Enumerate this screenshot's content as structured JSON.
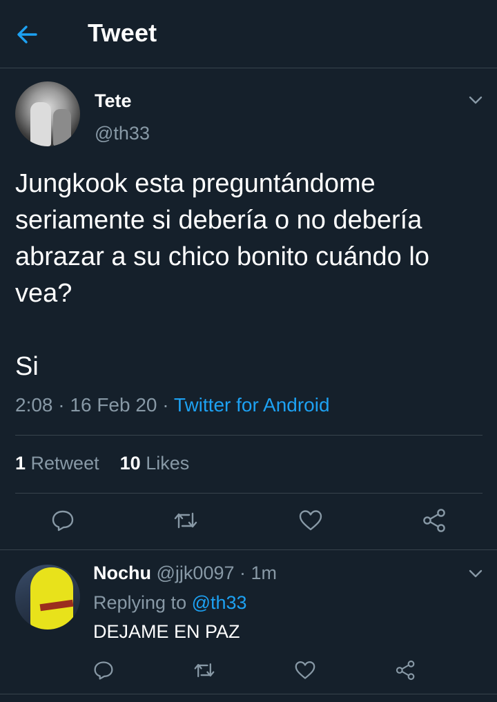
{
  "header": {
    "title": "Tweet",
    "back_icon": "arrow-left-icon"
  },
  "tweet": {
    "author": {
      "display_name": "Tete",
      "handle": "@th33"
    },
    "text": "Jungkook esta preguntándome seriamente si debería o no debería abrazar a su chico bonito cuándo lo vea?",
    "text_2": "Si",
    "time": "2:08",
    "date": "16 Feb 20",
    "source": "Twitter for Android",
    "separator": "·",
    "stats": {
      "retweets_count": "1",
      "retweets_label": "Retweet",
      "likes_count": "10",
      "likes_label": "Likes"
    },
    "actions": [
      "reply-icon",
      "retweet-icon",
      "like-icon",
      "share-icon"
    ]
  },
  "reply": {
    "display_name": "Nochu",
    "handle": "@jjk0097",
    "separator": "·",
    "time": "1m",
    "replying_label": "Replying to",
    "replying_to": "@th33",
    "text": "DEJAME EN PAZ"
  },
  "colors": {
    "background": "#15202b",
    "accent": "#1da1f2",
    "secondary_text": "#8899a6",
    "divider": "#38444d"
  }
}
